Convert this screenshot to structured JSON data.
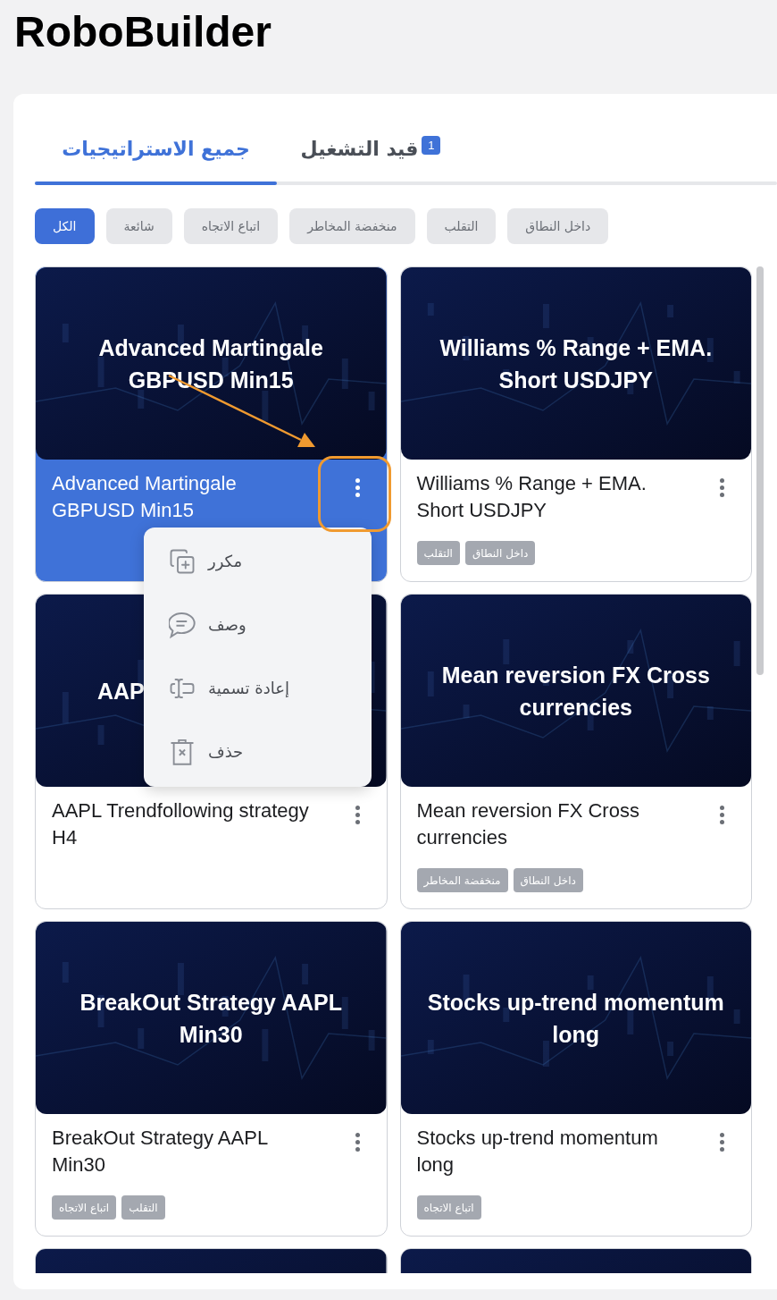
{
  "app_title": "RoboBuilder",
  "tabs": [
    {
      "label": "قيد التشغيل",
      "badge": "1",
      "selected": false
    },
    {
      "label": "جميع الاستراتيجيات",
      "selected": true
    }
  ],
  "filters": [
    {
      "label": "داخل النطاق",
      "selected": false
    },
    {
      "label": "التقلب",
      "selected": false
    },
    {
      "label": "منخفضة المخاطر",
      "selected": false
    },
    {
      "label": "اتباع الاتجاه",
      "selected": false
    },
    {
      "label": "شائعة",
      "selected": false
    },
    {
      "label": "الكل",
      "selected": true
    }
  ],
  "cards": [
    {
      "kind": "full",
      "image_title": "Williams % Range + EMA. Short USDJPY",
      "title": "Williams % Range + EMA. Short USDJPY",
      "selected": false,
      "tags": [
        "داخل النطاق",
        "التقلب"
      ]
    },
    {
      "kind": "full",
      "image_title": "Advanced Martingale GBPUSD Min15",
      "title": "Advanced Martingale GBPUSD Min15",
      "selected": true,
      "menu": {
        "open": true,
        "items": [
          {
            "kind": "duplicate",
            "label": "مكرر"
          },
          {
            "kind": "describe",
            "label": "وصف"
          },
          {
            "kind": "rename",
            "label": "إعادة تسمية"
          },
          {
            "kind": "delete",
            "label": "حذف"
          }
        ]
      }
    },
    {
      "kind": "full",
      "image_title": "Mean reversion FX Cross currencies",
      "title": "Mean reversion FX Cross currencies",
      "selected": false,
      "tags": [
        "داخل النطاق",
        "منخفضة المخاطر"
      ]
    },
    {
      "kind": "full",
      "image_title": "AAP",
      "covered": true,
      "title": "AAPL Trendfollowing strategy H4",
      "selected": false
    },
    {
      "kind": "full",
      "image_title": "Stocks up-trend momentum long",
      "title": "Stocks up-trend momentum long",
      "selected": false,
      "tags": [
        "اتباع الاتجاه"
      ]
    },
    {
      "kind": "full",
      "image_title": "BreakOut Strategy AAPL Min30",
      "title": "BreakOut Strategy AAPL Min30",
      "selected": false,
      "tags": [
        "التقلب",
        "اتباع الاتجاه"
      ]
    },
    {
      "kind": "cut"
    },
    {
      "kind": "cut"
    }
  ]
}
